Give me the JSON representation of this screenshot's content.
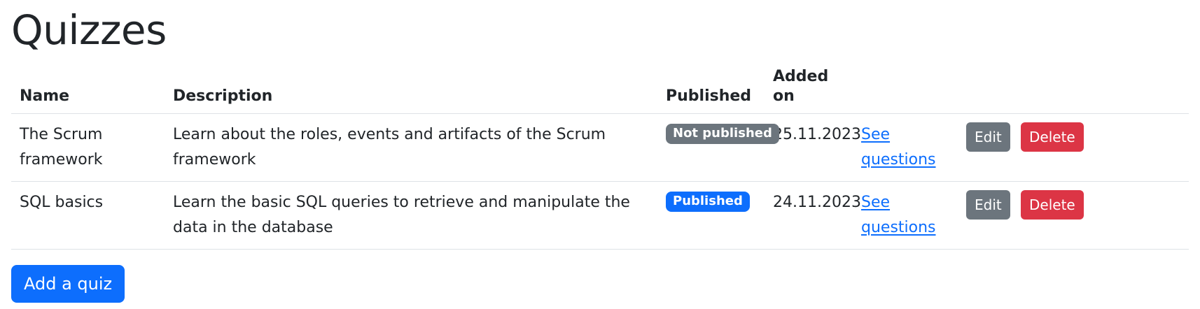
{
  "page": {
    "title": "Quizzes"
  },
  "table": {
    "headers": {
      "name": "Name",
      "description": "Description",
      "published": "Published",
      "added_on": "Added on"
    },
    "rows": [
      {
        "name": "The Scrum framework",
        "description": "Learn about the roles, events and artifacts of the Scrum framework",
        "status": "Not published",
        "added_on": "25.11.2023",
        "see_link": "See questions",
        "edit_label": "Edit",
        "delete_label": "Delete"
      },
      {
        "name": "SQL basics",
        "description": "Learn the basic SQL queries to retrieve and manipulate the data in the database",
        "status": "Published",
        "added_on": "24.11.2023",
        "see_link": "See questions",
        "edit_label": "Edit",
        "delete_label": "Delete"
      }
    ]
  },
  "actions": {
    "add_quiz_label": "Add a quiz"
  },
  "colors": {
    "primary": "#0d6efd",
    "secondary": "#6c757d",
    "danger": "#dc3545",
    "text": "#212529",
    "border": "#dee2e6"
  }
}
